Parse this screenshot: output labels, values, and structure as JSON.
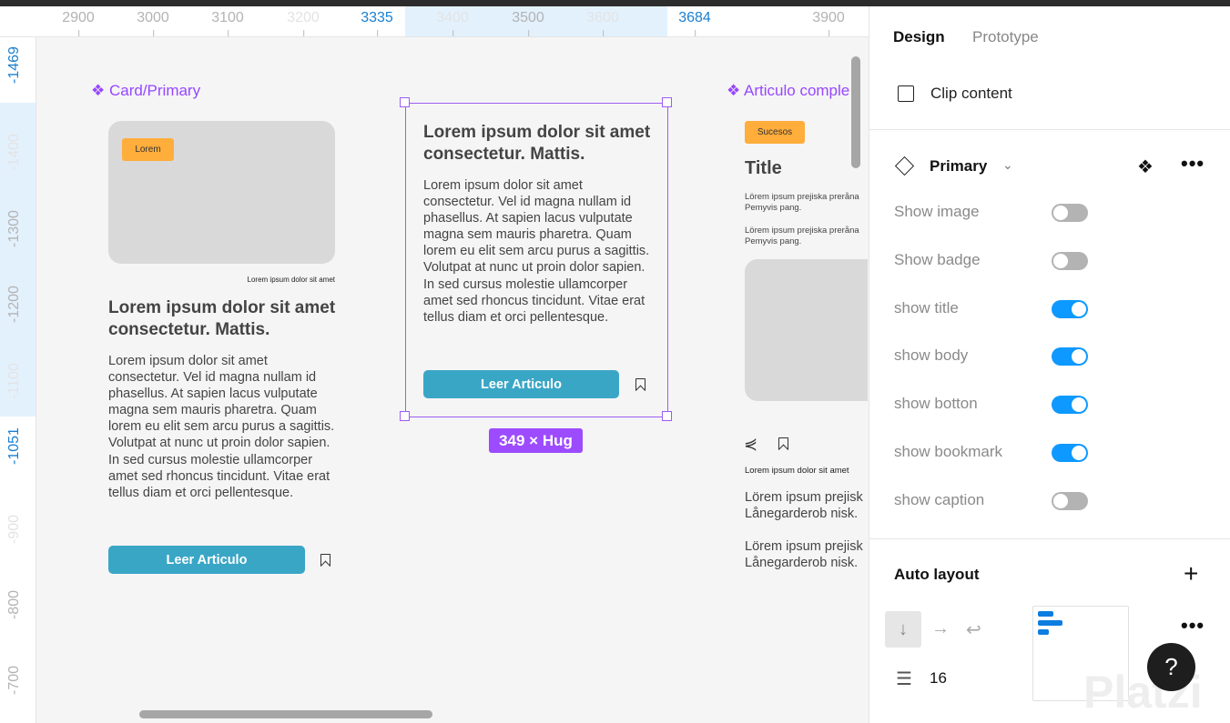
{
  "rulers": {
    "horizontal": [
      {
        "label": "2900",
        "style": "normal"
      },
      {
        "label": "3000",
        "style": "normal"
      },
      {
        "label": "3100",
        "style": "normal"
      },
      {
        "label": "3200",
        "style": "faint"
      },
      {
        "label": "3335",
        "style": "blue"
      },
      {
        "label": "3400",
        "style": "faint"
      },
      {
        "label": "3500",
        "style": "normal"
      },
      {
        "label": "3600",
        "style": "faint"
      },
      {
        "label": "3684",
        "style": "blue"
      },
      {
        "label": "3900",
        "style": "normal"
      }
    ],
    "vertical": [
      {
        "label": "-1469",
        "style": "blue"
      },
      {
        "label": "-1400",
        "style": "faint"
      },
      {
        "label": "-1300",
        "style": "normal"
      },
      {
        "label": "-1200",
        "style": "normal"
      },
      {
        "label": "-1100",
        "style": "faint"
      },
      {
        "label": "-1051",
        "style": "blue"
      },
      {
        "label": "-900",
        "style": "faint"
      },
      {
        "label": "-800",
        "style": "normal"
      },
      {
        "label": "-700",
        "style": "normal"
      }
    ]
  },
  "canvas": {
    "card1": {
      "component_label": "Card/Primary",
      "badge": "Lorem",
      "caption": "Lorem ipsum dolor sit amet",
      "title": "Lorem ipsum dolor sit amet consectetur. Mattis.",
      "body": "Lorem ipsum dolor sit amet consectetur. Vel id magna nullam id phasellus. At sapien lacus vulputate magna sem mauris pharetra. Quam lorem eu elit sem arcu purus a sagittis. Volutpat at nunc ut proin dolor sapien. In sed cursus molestie ullamcorper amet sed rhoncus tincidunt. Vitae erat tellus diam et orci pellentesque.",
      "button": "Leer Articulo"
    },
    "card2": {
      "title": "Lorem ipsum dolor sit amet consectetur. Mattis.",
      "body": "Lorem ipsum dolor sit amet consectetur. Vel id magna nullam id phasellus. At sapien lacus vulputate magna sem mauris pharetra. Quam lorem eu elit sem arcu purus a sagittis. Volutpat at nunc ut proin dolor sapien. In sed cursus molestie ullamcorper amet sed rhoncus tincidunt. Vitae erat tellus diam et orci pellentesque.",
      "button": "Leer Articulo",
      "size_label": "349 × Hug"
    },
    "card3": {
      "component_label": "Articulo comple",
      "badge": "Sucesos",
      "title": "Title",
      "para1": "Lörem ipsum prejiska prerånа Pemyvis pang.",
      "para2": "Lörem ipsum prejiska prerånа Pemyvis pang.",
      "caption": "Lorem ipsum dolor sit amet",
      "text1": "Lörem ipsum prejisk Lånegarderob nisk.",
      "text2": "Lörem ipsum prejisk Lånegarderob nisk."
    }
  },
  "panel": {
    "tabs": [
      "Design",
      "Prototype"
    ],
    "clip_content": {
      "label": "Clip content",
      "checked": false
    },
    "component": {
      "name": "Primary"
    },
    "properties": [
      {
        "label": "Show image",
        "on": false
      },
      {
        "label": "Show badge",
        "on": false
      },
      {
        "label": "show title",
        "on": true
      },
      {
        "label": "show body",
        "on": true
      },
      {
        "label": "show botton",
        "on": true
      },
      {
        "label": "show bookmark",
        "on": true
      },
      {
        "label": "show caption",
        "on": false
      }
    ],
    "auto_layout": {
      "title": "Auto layout",
      "direction": "vertical",
      "gap": "16"
    },
    "help": "?",
    "watermark": "Platzi",
    "colors": {
      "accent": "#0d99ff",
      "selection": "#9d5cf5",
      "component": "#9747ff",
      "button": "#3aa6c6",
      "badge": "#ffad3b"
    }
  }
}
